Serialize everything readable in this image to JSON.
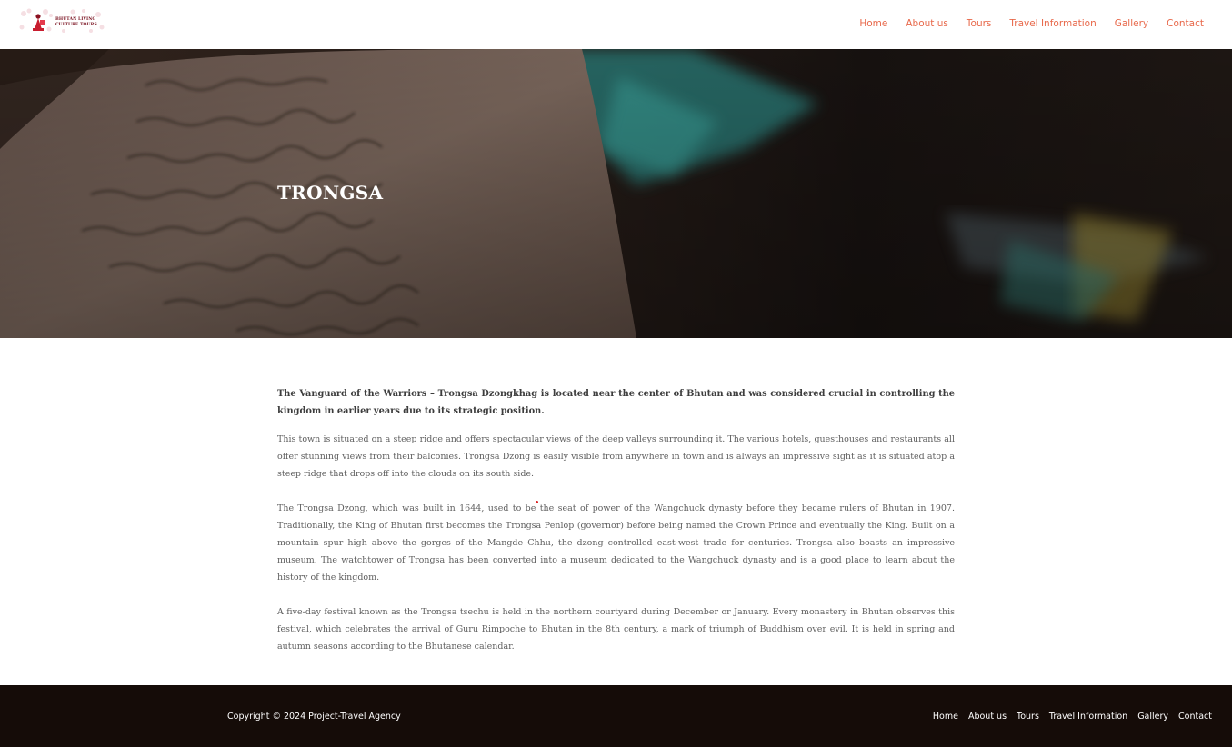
{
  "logo": {
    "line1": "BHUTAN LIVING",
    "line2": "CULTURE TOURS"
  },
  "nav": {
    "items": [
      "Home",
      "About us",
      "Tours",
      "Travel Information",
      "Gallery",
      "Contact"
    ]
  },
  "hero": {
    "title": "TRONGSA"
  },
  "content": {
    "lead": "The Vanguard of the Warriors – Trongsa Dzongkhag is located near the center of Bhutan and was considered crucial in controlling the kingdom in earlier years due to its strategic position.",
    "paragraphs": [
      "This town is situated on a steep ridge and offers spectacular views of the deep valleys surrounding it. The various hotels, guesthouses and restaurants all offer stunning views from their balconies. Trongsa Dzong is easily visible from anywhere in town and is always an impressive sight as it is situated atop a steep ridge that drops off into the clouds on its south side.",
      "The Trongsa Dzong, which was built in 1644, used to be the seat of power of the Wangchuck dynasty before they became rulers of Bhutan in 1907. Traditionally, the King of Bhutan first becomes the Trongsa Penlop (governor) before being named the Crown Prince and eventually the King. Built on a mountain spur high above the gorges of the Mangde Chhu, the dzong controlled east-west trade for centuries. Trongsa also boasts an impressive museum. The watchtower of Trongsa has been converted into a museum dedicated to the Wangchuck dynasty and is a good place to learn about the history of the kingdom.",
      "A five-day festival known as the Trongsa tsechu is held in the northern courtyard during December or January. Every monastery in Bhutan observes this festival, which celebrates the arrival of Guru Rimpoche to Bhutan in the 8th century, a mark of triumph of Buddhism over evil. It is held in spring and autumn seasons according to the Bhutanese calendar."
    ]
  },
  "footer": {
    "copyright": "Copyright © 2024 Project-Travel Agency",
    "nav": [
      "Home",
      "About us",
      "Tours",
      "Travel Information",
      "Gallery",
      "Contact"
    ]
  },
  "colors": {
    "nav": "#e8684a",
    "footer_bg": "#150c08",
    "hero_title": "#ffffff"
  },
  "icons": {
    "logo": "bhutan-living-culture-tours-logo"
  }
}
